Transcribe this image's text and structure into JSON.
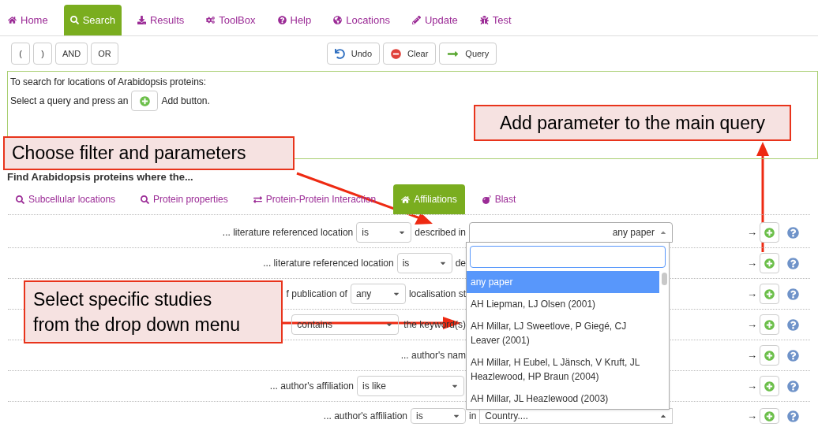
{
  "nav_tabs": [
    {
      "kind": "home",
      "label": "Home",
      "selected": false
    },
    {
      "kind": "search",
      "label": "Search",
      "selected": true
    },
    {
      "kind": "download",
      "label": "Results",
      "selected": false
    },
    {
      "kind": "cogs",
      "label": "ToolBox",
      "selected": false
    },
    {
      "kind": "help",
      "label": "Help",
      "selected": false
    },
    {
      "kind": "globe",
      "label": "Locations",
      "selected": false
    },
    {
      "kind": "pencil",
      "label": "Update",
      "selected": false
    },
    {
      "kind": "bug",
      "label": "Test",
      "selected": false
    }
  ],
  "logic_buttons": [
    "(",
    ")",
    "AND",
    "OR"
  ],
  "action_buttons": [
    {
      "kind": "undo",
      "label": "Undo"
    },
    {
      "kind": "clear",
      "label": "Clear"
    },
    {
      "kind": "query",
      "label": "Query"
    }
  ],
  "query_box": {
    "intro": "To search for locations of Arabidopsis proteins:",
    "instruction_before": "Select a query and press an",
    "instruction_after": "Add button."
  },
  "heading": "Find Arabidopsis proteins where the...",
  "filter_tabs": [
    {
      "kind": "search",
      "label": "Subcellular locations",
      "selected": false
    },
    {
      "kind": "search",
      "label": "Protein properties",
      "selected": false
    },
    {
      "kind": "exchange",
      "label": "Protein-Protein Interaction",
      "selected": false
    },
    {
      "kind": "home",
      "label": "Affiliations",
      "selected": true
    },
    {
      "kind": "bomb",
      "label": "Blast",
      "selected": false
    }
  ],
  "rows": [
    {
      "label": "... literature referenced location",
      "operator": "is",
      "after": "described in",
      "combobox": "any paper",
      "arrow": "→"
    },
    {
      "label": "... literature referenced location",
      "operator": "is",
      "after": "de",
      "arrow": "→"
    },
    {
      "label": "f publication of",
      "operator": "any",
      "after": "localisation st",
      "arrow": "→"
    },
    {
      "operator": "contains",
      "after": "the keyword(s)",
      "arrow": "→"
    },
    {
      "label": "... author's nam",
      "arrow": "→"
    },
    {
      "label": "... author's affiliation",
      "operator": "is like",
      "arrow": "→"
    },
    {
      "label": "... author's affiliation",
      "operator": "is",
      "in_text": "in",
      "field": "Country....",
      "arrow": "→"
    }
  ],
  "dropdown": {
    "options": [
      {
        "label": "any paper",
        "selected": true
      },
      {
        "label": "AH Liepman, LJ Olsen (2001)",
        "selected": false
      },
      {
        "label": "AH Millar, LJ Sweetlove, P Giegé, CJ Leaver (2001)",
        "selected": false
      },
      {
        "label": "AH Millar, H Eubel, L Jänsch, V Kruft, JL Heazlewood, HP Braun (2004)",
        "selected": false
      },
      {
        "label": "AH Millar, JL Heazlewood (2003)",
        "selected": false
      }
    ]
  },
  "callouts": {
    "filter": "Choose filter and parameters",
    "add": "Add parameter to the main query",
    "studies": "Select specific studies from the drop down menu"
  }
}
